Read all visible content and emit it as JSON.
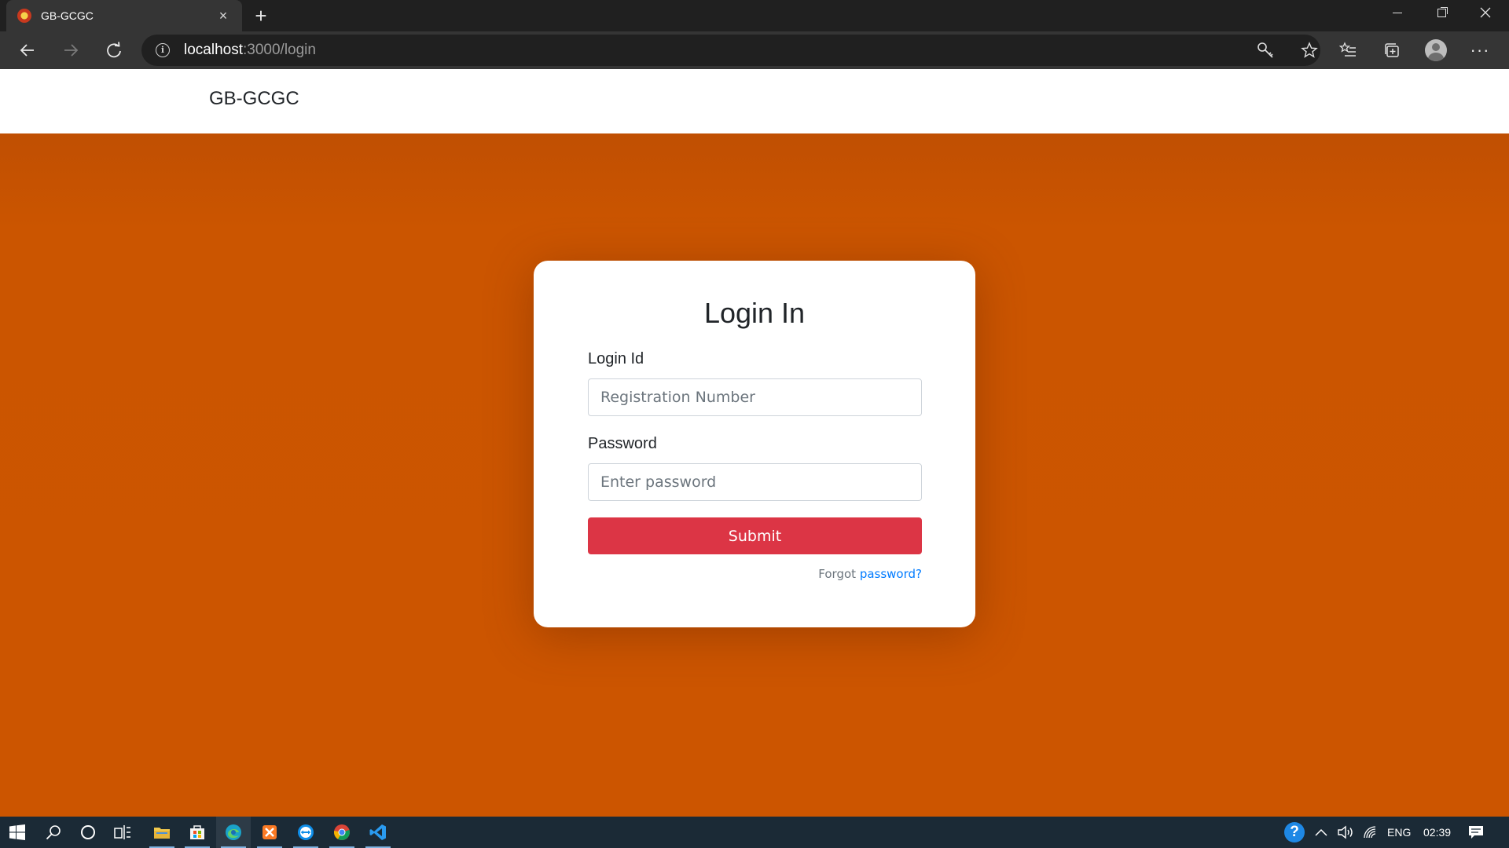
{
  "browser": {
    "tab_title": "GB-GCGC",
    "tab_close": "×",
    "new_tab": "+",
    "url_host": "localhost",
    "url_path": ":3000/login",
    "more": "···"
  },
  "site": {
    "brand": "GB-GCGC"
  },
  "login": {
    "title": "Login In",
    "login_id_label": "Login Id",
    "login_id_placeholder": "Registration Number",
    "password_label": "Password",
    "password_placeholder": "Enter password",
    "submit_label": "Submit",
    "forgot_prefix": "Forgot ",
    "forgot_link": "password?"
  },
  "taskbar": {
    "language": "ENG",
    "time": "02:39"
  },
  "colors": {
    "background": "#cc5500",
    "submit": "#dc3545",
    "link": "#007bff"
  }
}
